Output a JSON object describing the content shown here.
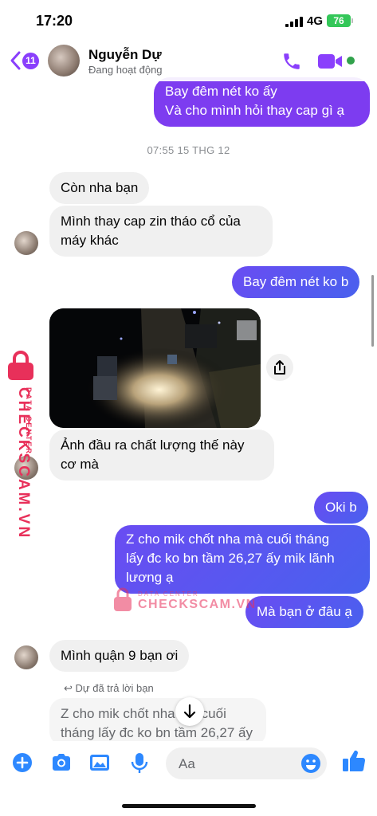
{
  "status_bar": {
    "time": "17:20",
    "network": "4G",
    "battery": "76"
  },
  "header": {
    "back_count": "11",
    "contact_name": "Nguyễn Dự",
    "contact_status": "Đang hoạt động",
    "icons": [
      "chevron-left-icon",
      "phone-icon",
      "video-camera-icon"
    ],
    "accent_color": "#8a3ffc"
  },
  "messages": {
    "m1": "Bay đêm nét ko ấy\nVà cho mình hỏi thay cap gì ạ",
    "timestamp": "07:55 15 THG 12",
    "m2": "Còn nha bạn",
    "m3": "Mình thay cap zin tháo cổ của\nmáy khác",
    "m4": "Bay đêm nét ko b",
    "m5": "Ảnh đầu ra chất lượng thế này\ncơ mà",
    "m6": "Oki b",
    "m7": "Z cho mik chốt nha mà cuối tháng\nlấy đc ko bn tầm 26,27 ấy mik lãnh\nlương ạ",
    "m8": "Mà bạn ở đâu ạ",
    "m9": "Mình quận 9 bạn ơi",
    "reply_label": "Dự đã trả lời bạn",
    "reply_quote": "Z cho mik chốt nha mà cuối\ntháng lấy đc ko bn tầm 26,27 ấy"
  },
  "composer": {
    "placeholder": "Aa",
    "icons": [
      "plus-icon",
      "camera-icon",
      "image-icon",
      "microphone-icon",
      "emoji-icon",
      "thumbs-up-icon"
    ]
  },
  "watermark": {
    "brand": "CHECKSCAM.VN",
    "sub": "DATA CENTER",
    "color": "#e8305a"
  }
}
